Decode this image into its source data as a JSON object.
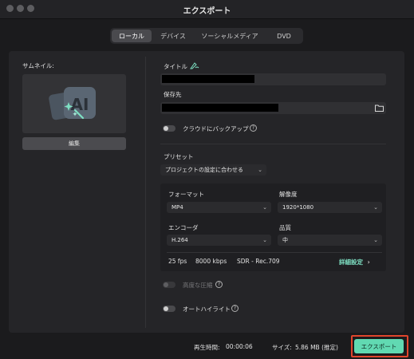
{
  "window": {
    "title": "エクスポート"
  },
  "tabs": [
    {
      "label": "ローカル",
      "active": true
    },
    {
      "label": "デバイス",
      "active": false
    },
    {
      "label": "ソーシャルメディア",
      "active": false
    },
    {
      "label": "DVD",
      "active": false
    }
  ],
  "thumbnail": {
    "label": "サムネイル:",
    "edit_label": "編集"
  },
  "title_field": {
    "label": "タイトル",
    "icon": "ai-pen-icon"
  },
  "save_to": {
    "label": "保存先",
    "icon": "folder-icon"
  },
  "cloud_backup": {
    "label": "クラウドにバックアップ",
    "enabled": false
  },
  "preset": {
    "label": "プリセット",
    "value": "プロジェクトの設定に合わせる"
  },
  "format": {
    "label": "フォーマット",
    "value": "MP4"
  },
  "resolution": {
    "label": "解像度",
    "value": "1920*1080"
  },
  "encoder": {
    "label": "エンコーダ",
    "value": "H.264"
  },
  "quality": {
    "label": "品質",
    "value": "中"
  },
  "summary": {
    "fps": "25 fps",
    "bitrate": "8000 kbps",
    "color": "SDR - Rec.709",
    "details_link": "詳細設定"
  },
  "advanced_compression": {
    "label": "高度な圧縮",
    "enabled": false,
    "disabled": true
  },
  "auto_highlight": {
    "label": "オートハイライト",
    "enabled": false
  },
  "footer": {
    "duration_label": "再生時間:",
    "duration_value": "00:00:06",
    "size_label": "サイズ:",
    "size_value": "5.86 MB (推定)",
    "export_label": "エクスポート"
  },
  "colors": {
    "accent": "#61d9b2",
    "highlight_outline": "#e0452c"
  }
}
